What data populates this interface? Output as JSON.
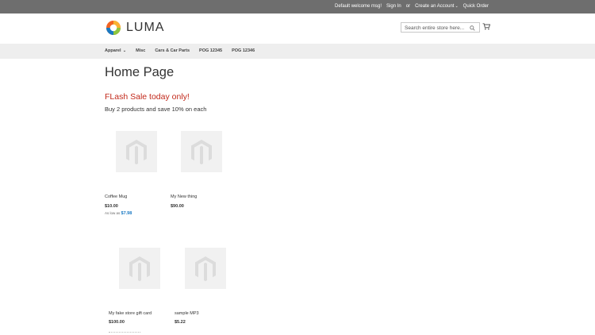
{
  "topbar": {
    "welcome": "Default welcome msg!",
    "sign_in": "Sign In",
    "or": "or",
    "create_account": "Create an Account",
    "quick_order": "Quick Order"
  },
  "header": {
    "logo_text": "LUMA",
    "search_placeholder": "Search entire store here...",
    "icons": [
      "search-icon",
      "cart-icon"
    ]
  },
  "nav": {
    "items": [
      "Apparel",
      "Misc",
      "Cars & Car Parts",
      "POG 12345",
      "POG 12346"
    ]
  },
  "main": {
    "title": "Home Page",
    "flash": "FLash Sale today only!",
    "promo": "Buy 2 products and save 10% on each",
    "products": [
      {
        "name": "Coffee Mug",
        "price": "$10.00",
        "as_low_as_label": "As low as",
        "as_low_as_price": "$7.98"
      },
      {
        "name": "My New thing",
        "price": "$90.00"
      },
      {
        "name": "My fake store gift card",
        "price": "$100.00"
      },
      {
        "name": "sample MP3",
        "price": "$5.22"
      }
    ]
  },
  "colors": {
    "topbar": "#6e6e6e",
    "nav": "#eeeeee",
    "flash": "#c2291b",
    "link": "#1979c3"
  }
}
